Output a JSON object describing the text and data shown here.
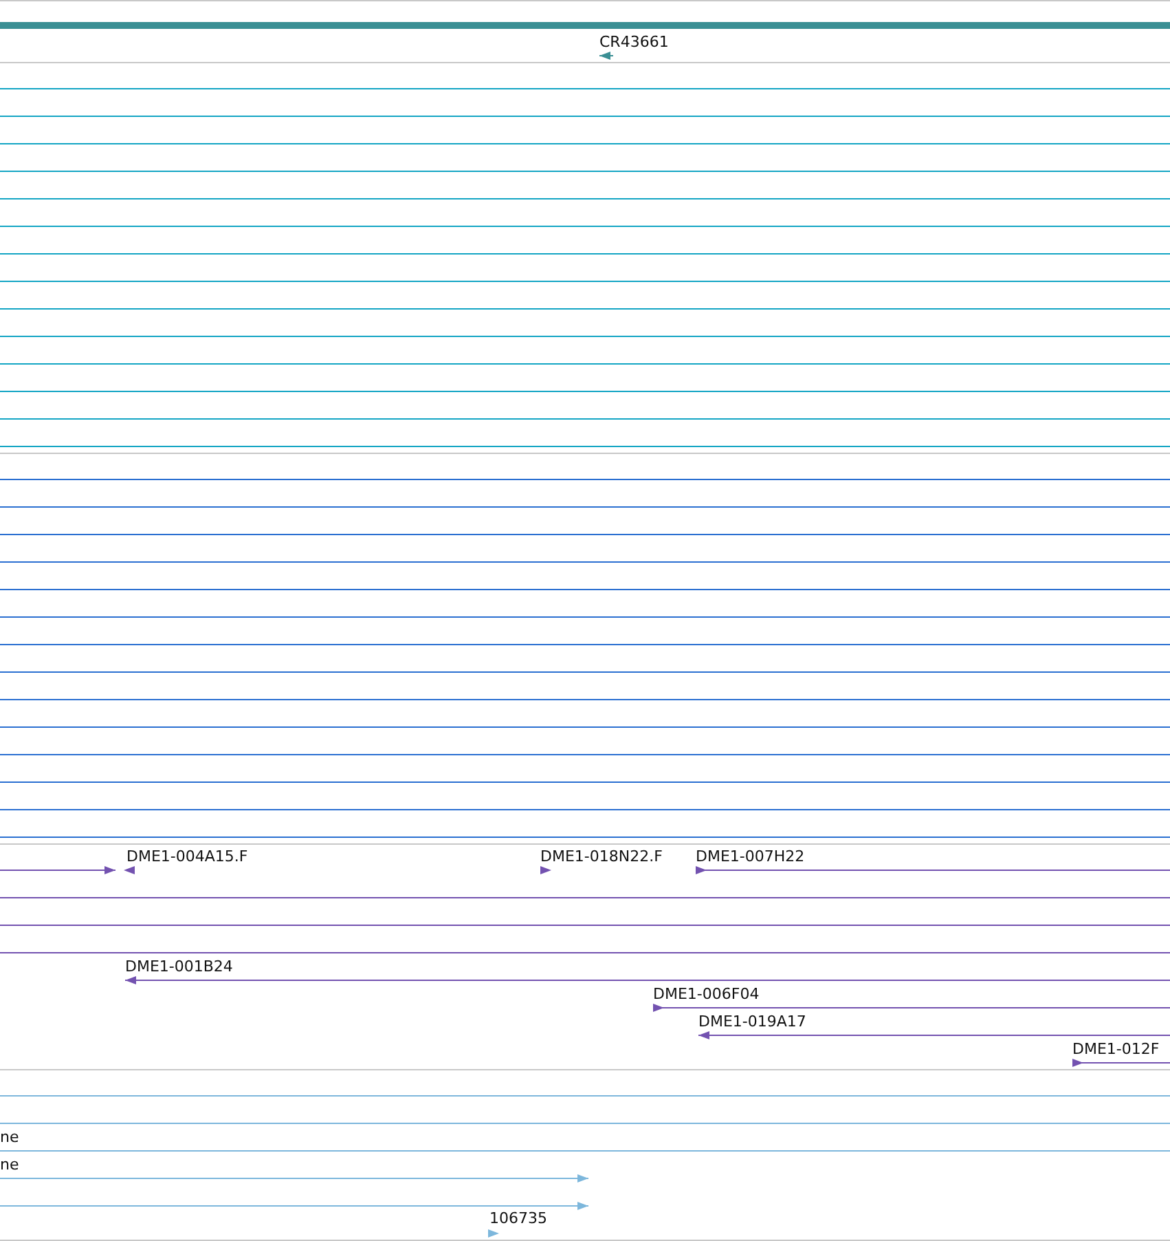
{
  "tracks": [
    {
      "color": "#3a8f94",
      "features": [
        {
          "label": "CR43661"
        }
      ]
    },
    {
      "color": "#13a5c4"
    },
    {
      "color": "#2a6fd1"
    },
    {
      "color": "#7352b0",
      "features": [
        {
          "label": "DME1-004A15.F"
        },
        {
          "label": "DME1-018N22.F"
        },
        {
          "label": "DME1-007H22"
        },
        {
          "label": "DME1-001B24"
        },
        {
          "label": "DME1-006F04"
        },
        {
          "label": "DME1-019A17"
        },
        {
          "label": "DME1-012F"
        }
      ]
    },
    {
      "color": "#7db7dc",
      "features": [
        {
          "label": "ne"
        },
        {
          "label": "ne"
        },
        {
          "label": "106735"
        }
      ]
    }
  ]
}
